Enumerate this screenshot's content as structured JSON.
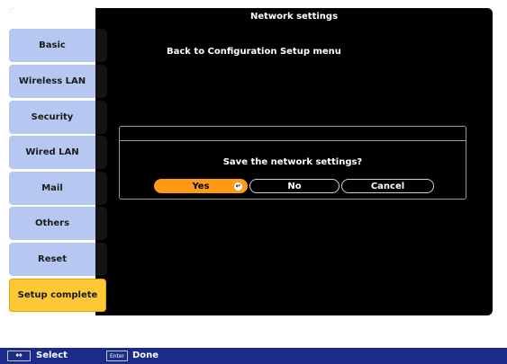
{
  "window": {
    "title": "Network settings"
  },
  "sidebar": {
    "items": [
      {
        "label": "Basic",
        "active": false
      },
      {
        "label": "Wireless LAN",
        "active": false
      },
      {
        "label": "Security",
        "active": false
      },
      {
        "label": "Wired LAN",
        "active": false
      },
      {
        "label": "Mail",
        "active": false
      },
      {
        "label": "Others",
        "active": false
      },
      {
        "label": "Reset",
        "active": false
      },
      {
        "label": "Setup complete",
        "active": true
      }
    ]
  },
  "main": {
    "back_link": "Back to Configuration Setup menu"
  },
  "dialog": {
    "message": "Save the network settings?",
    "buttons": {
      "yes": "Yes",
      "no": "No",
      "cancel": "Cancel"
    },
    "enter_icon": "↵"
  },
  "status_bar": {
    "select_key": "↔",
    "select_label": "Select",
    "enter_key": "Enter",
    "done_label": "Done"
  },
  "colors": {
    "sidebar_item": "#b6c8f2",
    "sidebar_active": "#ffc836",
    "button_selected": "#ff9a16",
    "status_bar": "#1a2b8a"
  }
}
